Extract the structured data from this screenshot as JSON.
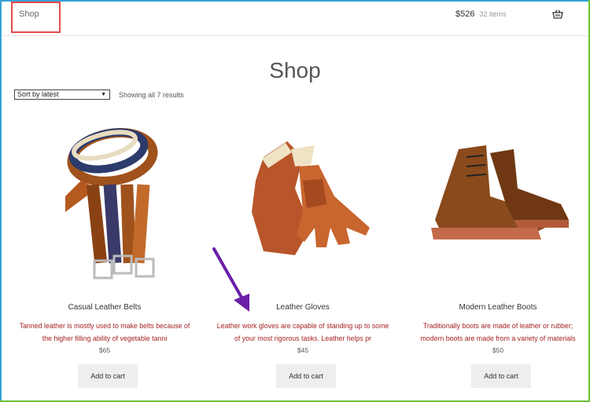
{
  "header": {
    "nav_shop": "Shop",
    "cart_amount": "$526",
    "cart_count": "32 items"
  },
  "page": {
    "title": "Shop",
    "sort_selected": "Sort by latest",
    "result_count": "Showing all 7 results"
  },
  "products": [
    {
      "title": "Casual Leather Belts",
      "desc_line1": "Tanned leather is mostly used to make belts because of",
      "desc_line2": "the higher filling ability of vegetable tanni",
      "price": "$65",
      "cta": "Add to cart"
    },
    {
      "title": "Leather Gloves",
      "desc_line1": "Leather work gloves are capable of standing up to some",
      "desc_line2": "of your most rigorous tasks. Leather helps pr",
      "price": "$45",
      "cta": "Add to cart"
    },
    {
      "title": "Modern Leather Boots",
      "desc_line1": "Traditionally boots are made of leather or rubber;",
      "desc_line2": "modern boots are made from a variety of materials",
      "price": "$50",
      "cta": "Add to cart"
    }
  ],
  "colors": {
    "highlight": "#e64a4a",
    "arrow": "#6b1fa8",
    "description": "#a52222"
  }
}
